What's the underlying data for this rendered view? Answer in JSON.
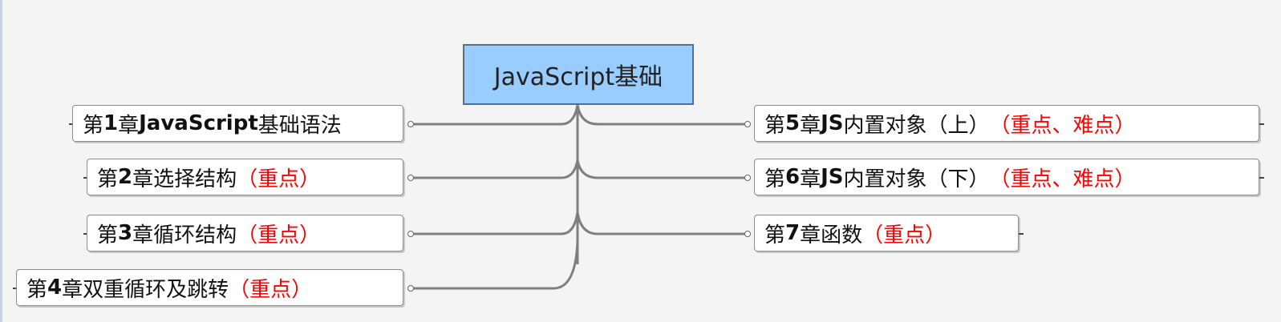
{
  "root": {
    "label": "JavaScript基础"
  },
  "chapters": [
    {
      "prefix": "第",
      "num": "1",
      "suffix": "章 ",
      "bold": "JavaScript",
      "title": "基础语法",
      "highlight": ""
    },
    {
      "prefix": "第",
      "num": "2",
      "suffix": "章 ",
      "bold": "",
      "title": "选择结构",
      "highlight": "（重点）"
    },
    {
      "prefix": "第",
      "num": "3",
      "suffix": "章 ",
      "bold": "",
      "title": "循环结构",
      "highlight": "（重点）"
    },
    {
      "prefix": "第",
      "num": "4",
      "suffix": "章 ",
      "bold": "",
      "title": "双重循环及跳转",
      "highlight": "（重点）"
    },
    {
      "prefix": "第",
      "num": "5",
      "suffix": "章 ",
      "bold": "JS",
      "title": " 内置对象（上）",
      "highlight": "（重点、难点）"
    },
    {
      "prefix": "第",
      "num": "6",
      "suffix": "章 ",
      "bold": "JS",
      "title": " 内置对象（下）",
      "highlight": "（重点、难点）"
    },
    {
      "prefix": "第",
      "num": "7",
      "suffix": "章 ",
      "bold": "",
      "title": "函数",
      "highlight": "（重点）"
    }
  ],
  "colors": {
    "root_fill": "#99ccff",
    "highlight": "#ff0000",
    "connector": "#7f7f7f"
  }
}
